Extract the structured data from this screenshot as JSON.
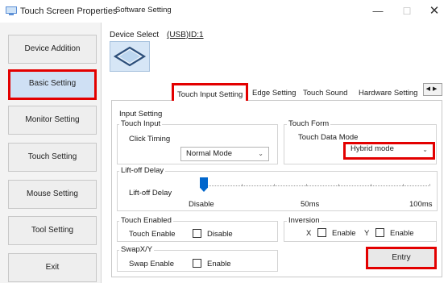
{
  "window": {
    "title": "Touch Screen Properties",
    "minimize_glyph": "—",
    "maximize_glyph": "☐",
    "close_glyph": "✕"
  },
  "sidebar": {
    "items": [
      {
        "label": "Device Addition",
        "selected": false
      },
      {
        "label": "Basic Setting",
        "selected": true
      },
      {
        "label": "Monitor Setting",
        "selected": false
      },
      {
        "label": "Touch Setting",
        "selected": false
      },
      {
        "label": "Mouse Setting",
        "selected": false
      },
      {
        "label": "Tool Setting",
        "selected": false
      },
      {
        "label": "Exit",
        "selected": false
      }
    ]
  },
  "device_select": {
    "label": "Device Select",
    "value": "(USB)ID:1"
  },
  "tabs": [
    {
      "label": "Software Setting",
      "active": false
    },
    {
      "label": "Touch Input Setting",
      "active": true
    },
    {
      "label": "Edge Setting",
      "active": false
    },
    {
      "label": "Touch Sound",
      "active": false
    },
    {
      "label": "Hardware Setting",
      "active": false
    }
  ],
  "tab_scroll": {
    "left": "◀",
    "right": "▶"
  },
  "input_setting": {
    "title": "Input Setting",
    "touch_input": {
      "title": "Touch Input",
      "click_timing_label": "Click Timing",
      "click_timing_value": "Normal Mode"
    },
    "touch_form": {
      "title": "Touch Form",
      "touch_data_mode_label": "Touch Data Mode",
      "touch_data_mode_value": "Hybrid mode"
    }
  },
  "lift_off": {
    "title": "Lift-off Delay",
    "label": "Lift-off Delay",
    "min_label": "Disable",
    "mid_label": "50ms",
    "max_label": "100ms",
    "value_fraction": 0
  },
  "touch_enabled": {
    "title": "Touch Enabled",
    "label": "Touch Enable",
    "checkbox_label": "Disable",
    "checked": false
  },
  "inversion": {
    "title": "Inversion",
    "x_label": "X",
    "x_checkbox_label": "Enable",
    "x_checked": false,
    "y_label": "Y",
    "y_checkbox_label": "Enable",
    "y_checked": false
  },
  "swap": {
    "title": "SwapX/Y",
    "label": "Swap Enable",
    "checkbox_label": "Enable",
    "checked": false
  },
  "entry_button": "Entry",
  "colors": {
    "highlight": "#e30000",
    "selected_bg": "#cfe0f4",
    "slider": "#0066cc"
  }
}
